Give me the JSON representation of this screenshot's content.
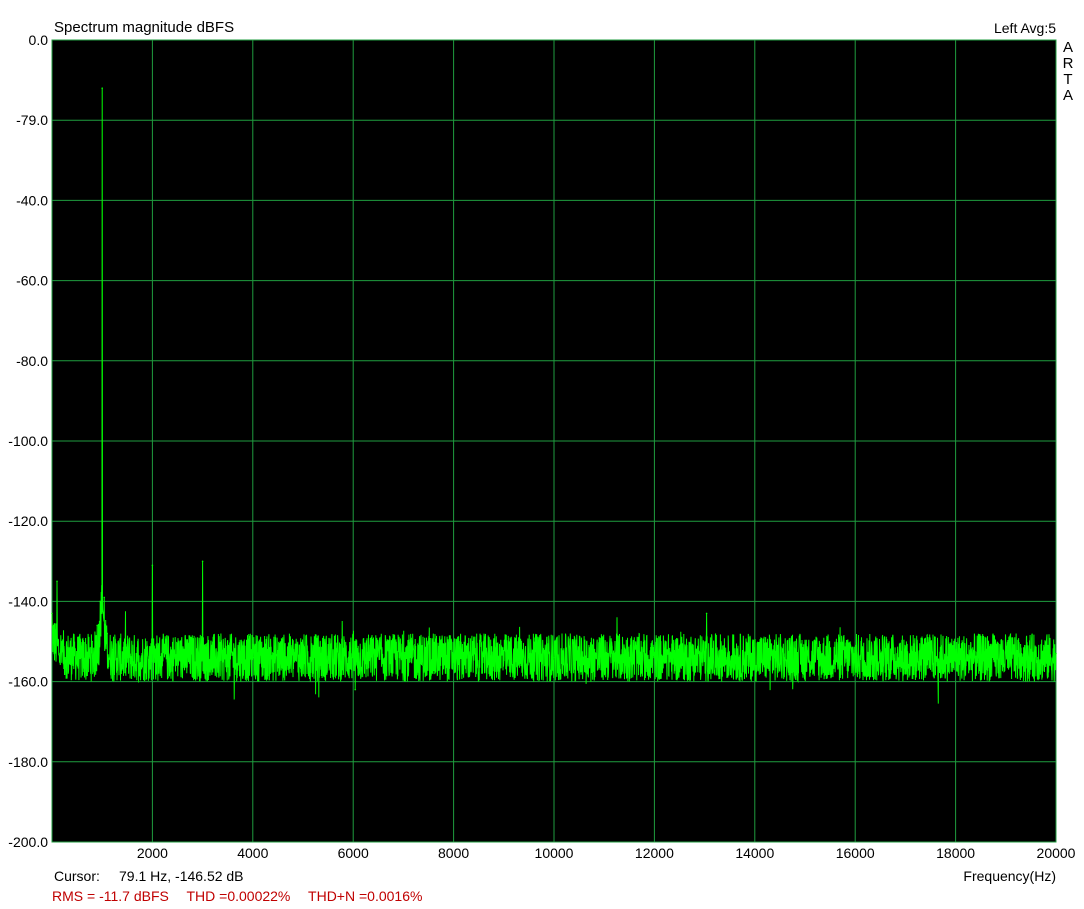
{
  "header": {
    "title": "Spectrum magnitude dBFS",
    "channel": "Left  Avg:5",
    "watermark": [
      "A",
      "R",
      "T",
      "A"
    ]
  },
  "footer": {
    "cursor_label": "Cursor:",
    "cursor_value": "79.1 Hz, -146.52 dB",
    "xlabel": "Frequency(Hz)",
    "stats": {
      "rms": "RMS =  -11.7 dBFS",
      "thd": "THD =0.00022%",
      "thdn": "THD+N =0.0016%"
    }
  },
  "colors": {
    "background": "#000000",
    "grid": "#1f9d3f",
    "trace": "#00ff00",
    "stats_text": "#c00000"
  },
  "chart_data": {
    "type": "line",
    "title": "Spectrum magnitude dBFS",
    "xlabel": "Frequency(Hz)",
    "ylabel": "",
    "xlim": [
      0,
      20000
    ],
    "ylim": [
      -200,
      0
    ],
    "grid": true,
    "x_ticks": [
      2000,
      4000,
      6000,
      8000,
      10000,
      12000,
      14000,
      16000,
      18000,
      20000
    ],
    "x_tick_labels": [
      "2000",
      "4000",
      "6000",
      "8000",
      "10000",
      "12000",
      "14000",
      "16000",
      "18000",
      "20000"
    ],
    "y_ticks": [
      0,
      -20,
      -40,
      -60,
      -80,
      -100,
      -120,
      -140,
      -160,
      -180,
      -200
    ],
    "y_tick_labels": [
      "0.0",
      "-79.0",
      "-40.0",
      "-60.0",
      "-80.0",
      "-100.0",
      "-120.0",
      "-140.0",
      "-160.0",
      "-180.0",
      "-200.0"
    ],
    "noise_floor_db": -154,
    "series": [
      {
        "name": "",
        "x": [
          0,
          100,
          200,
          400,
          600,
          800,
          900,
          960,
          1000,
          1040,
          1100,
          1200,
          1500,
          1990,
          2000,
          2010,
          2500,
          2990,
          3000,
          3010,
          4000,
          6000,
          6040,
          8000,
          10000,
          12000,
          13000,
          13040,
          14000,
          16000,
          18000,
          20000
        ],
        "y": [
          -143,
          -135,
          -150,
          -152,
          -154,
          -150,
          -146,
          -140,
          -12,
          -139,
          -148,
          -152,
          -154,
          -153,
          -131,
          -152,
          -154,
          -153,
          -130,
          -152,
          -154,
          -154,
          -162,
          -154,
          -154,
          -154,
          -154,
          -143,
          -154,
          -153,
          -153,
          -153
        ]
      }
    ]
  }
}
